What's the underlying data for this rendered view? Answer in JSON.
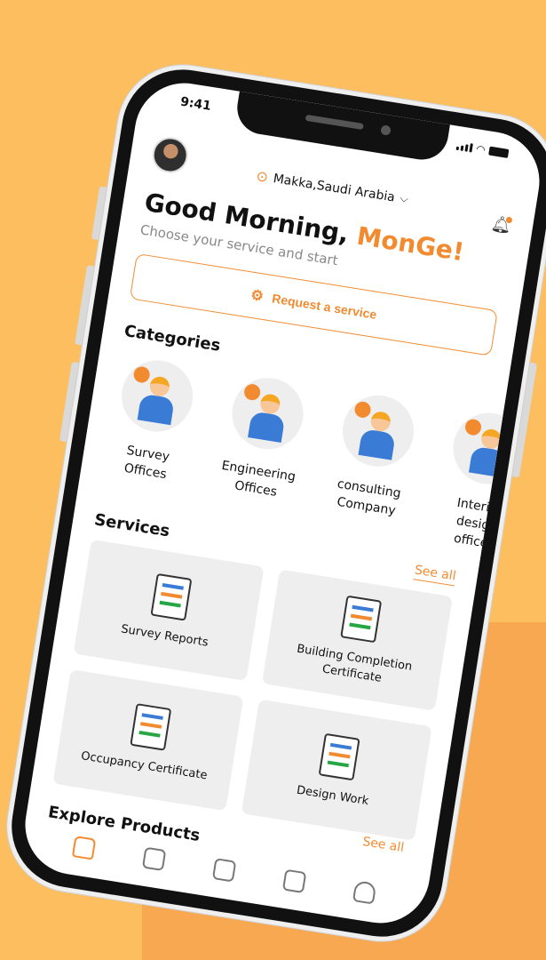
{
  "status": {
    "time": "9:41"
  },
  "header": {
    "location": "Makka,Saudi Arabia"
  },
  "greeting": {
    "prefix": "Good Morning, ",
    "name": "MonGe!",
    "subtitle": "Choose your service and start"
  },
  "request": {
    "label": "Request a service"
  },
  "categories": {
    "title": "Categories",
    "items": [
      {
        "label": "Survey Offices"
      },
      {
        "label": "Engineering Offices"
      },
      {
        "label": "consulting Company"
      },
      {
        "label": "Interior design offices"
      }
    ]
  },
  "services": {
    "title": "Services",
    "see_all": "See all",
    "items": [
      {
        "label": "Survey Reports"
      },
      {
        "label": "Building Completion Certificate"
      },
      {
        "label": "Occupancy Certificate"
      },
      {
        "label": "Design Work"
      }
    ]
  },
  "explore": {
    "title": "Explore Products",
    "see_all": "See all"
  },
  "nav": {
    "items": [
      "home-icon",
      "store-icon",
      "orders-icon",
      "chat-icon",
      "profile-icon"
    ]
  },
  "colors": {
    "accent": "#F28B30",
    "background": "#FDBE5F",
    "card": "#EEEEEE"
  }
}
